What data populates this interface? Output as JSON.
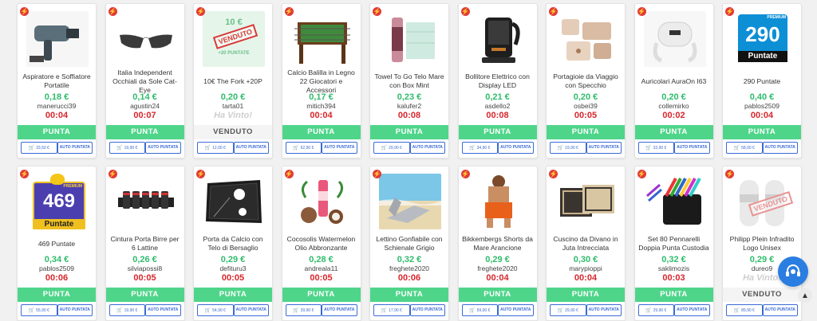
{
  "labels": {
    "bid": "PUNTA",
    "sold": "VENDUTO",
    "won": "Ha Vinto!",
    "auto": "AUTO PUNTATA",
    "stamp": "VENDUTO"
  },
  "colors": {
    "price": "#2ebc6b",
    "timer": "#d8262c",
    "bid": "#4fd58a",
    "accent": "#3a6bd6"
  },
  "row1": [
    {
      "title": "Aspiratore e Soffiatore Portatile",
      "price": "0,18 €",
      "user": "manerucci39",
      "timer": "00:04",
      "buy": "33,50 €"
    },
    {
      "title": "Italia Independent Occhiali da Sole Cat-Eye",
      "price": "0,14 €",
      "user": "agustin24",
      "timer": "00:07",
      "buy": "19,90 €"
    },
    {
      "title": "10€ The Fork +20P",
      "price": "0,20 €",
      "user": "tarta01",
      "timer": "Ha Vinto!",
      "buy": "12,00 €",
      "image_text": "10 €",
      "image_sub": "+20 PUNTATE"
    },
    {
      "title": "Calcio Balilla in Legno 22 Giocatori e Accessori",
      "price": "0,17 €",
      "user": "mitich394",
      "timer": "00:04",
      "buy": "62,90 €"
    },
    {
      "title": "Towel To Go Telo Mare con Box Mint",
      "price": "0,23 €",
      "user": "kalufer2",
      "timer": "00:08",
      "buy": "29,90 €"
    },
    {
      "title": "Bollitore Elettrico con Display LED",
      "price": "0,21 €",
      "user": "asdello2",
      "timer": "00:08",
      "buy": "34,90 €"
    },
    {
      "title": "Portagioie da Viaggio con Specchio",
      "price": "0,20 €",
      "user": "osbei39",
      "timer": "00:05",
      "buy": "19,90 €"
    },
    {
      "title": "Auricolari AuraOn I63",
      "price": "0,20 €",
      "user": "collemirko",
      "timer": "00:02",
      "buy": "33,90 €"
    },
    {
      "title": "290 Puntate",
      "price": "0,40 €",
      "user": "pablos2509",
      "timer": "00:04",
      "buy": "58,00 €",
      "image_badge": "PREMIUM",
      "image_num": "290",
      "image_label": "Puntate"
    }
  ],
  "row2": [
    {
      "title": "469 Puntate",
      "price": "0,34 €",
      "user": "pablos2509",
      "timer": "00:06",
      "buy": "55,90 €",
      "image_badge": "PREMIUM",
      "image_num": "469",
      "image_label": "Puntate"
    },
    {
      "title": "Cintura Porta Birre per 6 Lattine",
      "price": "0,26 €",
      "user": "silviapossi8",
      "timer": "00:05",
      "buy": "19,90 €"
    },
    {
      "title": "Porta da Calcio con Telo di Bersaglio",
      "price": "0,29 €",
      "user": "defituru3",
      "timer": "00:05",
      "buy": "54,90 €"
    },
    {
      "title": "Cocosolis Watermelon Olio Abbronzante",
      "price": "0,28 €",
      "user": "andreala11",
      "timer": "00:05",
      "buy": "39,90 €"
    },
    {
      "title": "Lettino Gonfiabile con Schienale Grigio",
      "price": "0,32 €",
      "user": "freghete2020",
      "timer": "00:06",
      "buy": "17,90 €"
    },
    {
      "title": "Bikkembergs Shorts da Mare Arancione",
      "price": "0,29 €",
      "user": "freghete2020",
      "timer": "00:04",
      "buy": "59,00 €"
    },
    {
      "title": "Cuscino da Divano in Juta Intrecciata",
      "price": "0,30 €",
      "user": "marypioppi",
      "timer": "00:04",
      "buy": "29,90 €"
    },
    {
      "title": "Set 80 Pennarelli Doppia Punta Custodia",
      "price": "0,32 €",
      "user": "saklimozis",
      "timer": "00:03",
      "buy": "29,90 €"
    },
    {
      "title": "Philipp Plein Infradito Logo Unisex",
      "price": "0,29 €",
      "user": "dureo9",
      "timer": "Ha Vinto!",
      "buy": "89,90 €"
    }
  ]
}
